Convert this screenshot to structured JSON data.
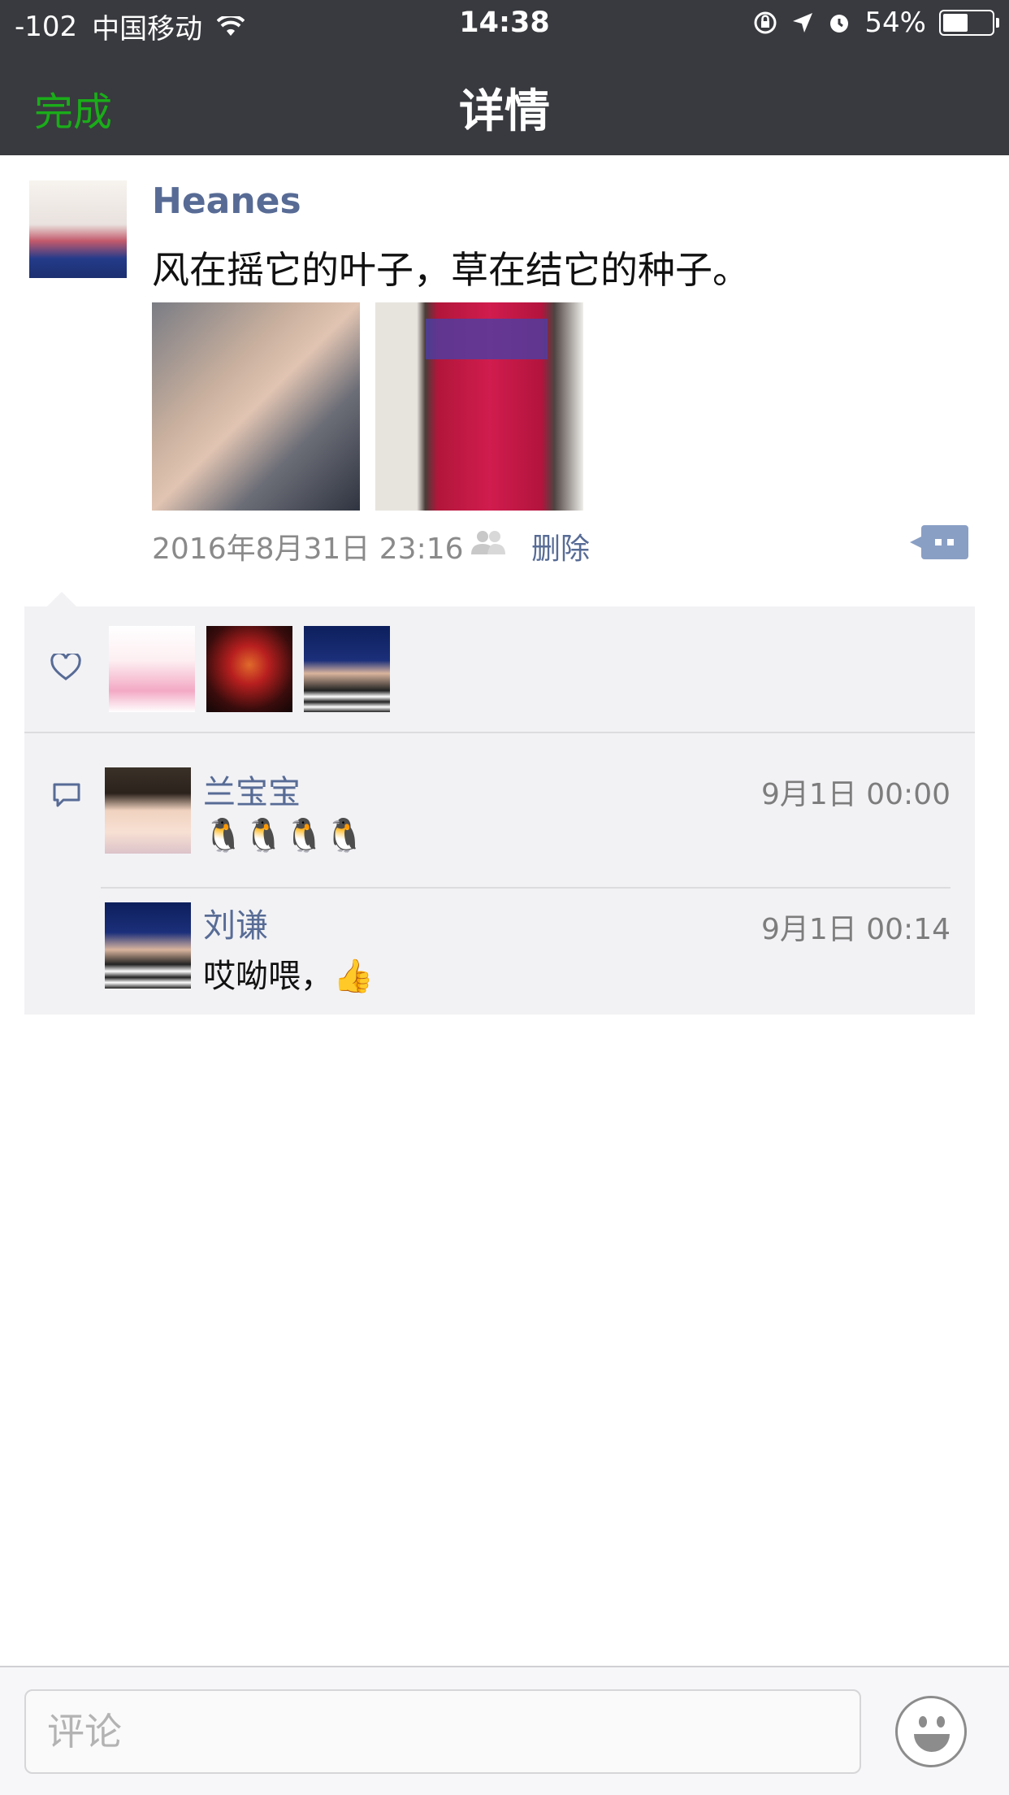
{
  "status_bar": {
    "signal": "-102",
    "carrier": "中国移动",
    "time": "14:38",
    "battery_percent": "54%",
    "battery_level": 0.54
  },
  "nav": {
    "done_label": "完成",
    "title": "详情"
  },
  "post": {
    "author": "Heanes",
    "text": "风在摇它的叶子，草在结它的种子。",
    "photos": [
      "photo-hands",
      "photo-roses"
    ],
    "timestamp": "2016年8月31日 23:16",
    "delete_label": "删除"
  },
  "likes": {
    "icon": "heart-icon",
    "avatars": [
      "avatar-cartoon-girl",
      "avatar-luffy",
      "avatar-cartoon-man"
    ]
  },
  "comments": [
    {
      "name": "兰宝宝",
      "time": "9月1日 00:00",
      "text": "🐧🐧🐧🐧"
    },
    {
      "name": "刘谦",
      "time": "9月1日 00:14",
      "text": "哎呦喂，👍"
    }
  ],
  "composer": {
    "placeholder": "评论",
    "emoji_icon": "smiley-icon"
  },
  "colors": {
    "nav_bg": "#393a3f",
    "link": "#576b95",
    "done": "#1aad19",
    "panel_bg": "#f2f2f5"
  }
}
